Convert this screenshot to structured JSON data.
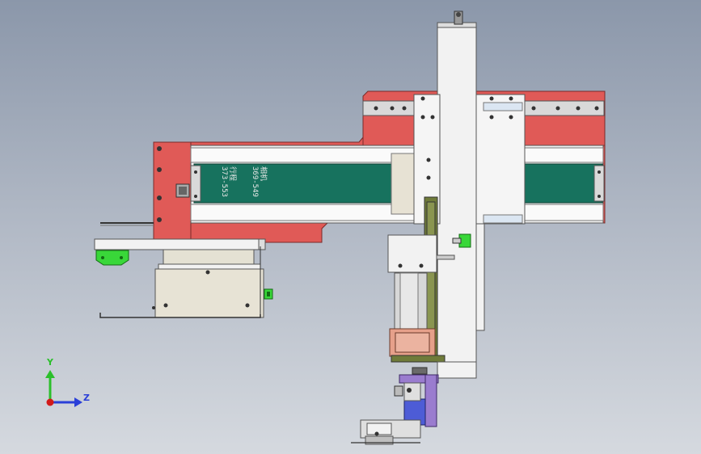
{
  "panel_text": {
    "line1": "相机",
    "line2": "369-549",
    "line3": "行程",
    "line4": "373-553"
  },
  "triad": {
    "y_label": "Y",
    "z_label": "Z"
  },
  "colors": {
    "background_top": "#8b97aa",
    "background_bottom": "#d5d9df",
    "red_frame": "#e05a57",
    "teal_panel": "#17725e",
    "white_part": "#f2f2f2",
    "green_axis": "#2bbf2b",
    "blue_axis": "#2a3fd8",
    "red_origin": "#d21a1a",
    "purple_part": "#9a7ccf",
    "salmon_part": "#e6a08a",
    "olive_part": "#6f7b3a",
    "bright_green": "#39d739"
  }
}
